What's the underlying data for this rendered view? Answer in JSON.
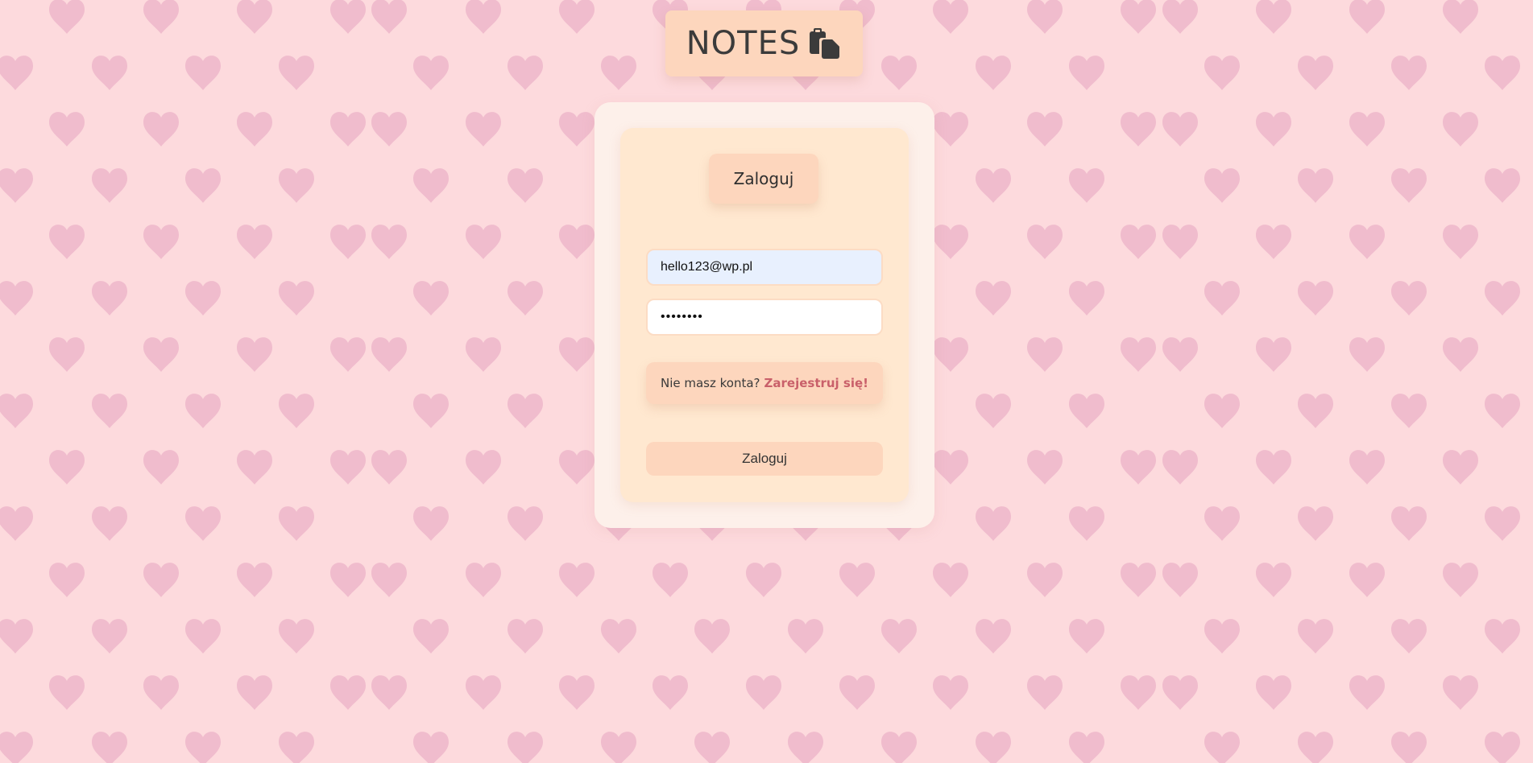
{
  "app": {
    "title": "NOTES",
    "logo_icon": "clipboard-copy-icon"
  },
  "login_form": {
    "heading": "Zaloguj",
    "email": {
      "value": "hello123@wp.pl"
    },
    "password": {
      "value": "••••••••"
    },
    "register_prompt": {
      "text": "Nie masz konta?",
      "link_label": "Zarejestruj się!"
    },
    "submit_label": "Zaloguj"
  },
  "colors": {
    "background": "#fddadd",
    "heart": "#f0bccd",
    "accent": "#fdd6bd",
    "card_outer": "#fdf0ea",
    "card_inner": "#ffe8d0",
    "link": "#c9606a"
  },
  "background_pattern": {
    "icon": "heart-icon"
  }
}
